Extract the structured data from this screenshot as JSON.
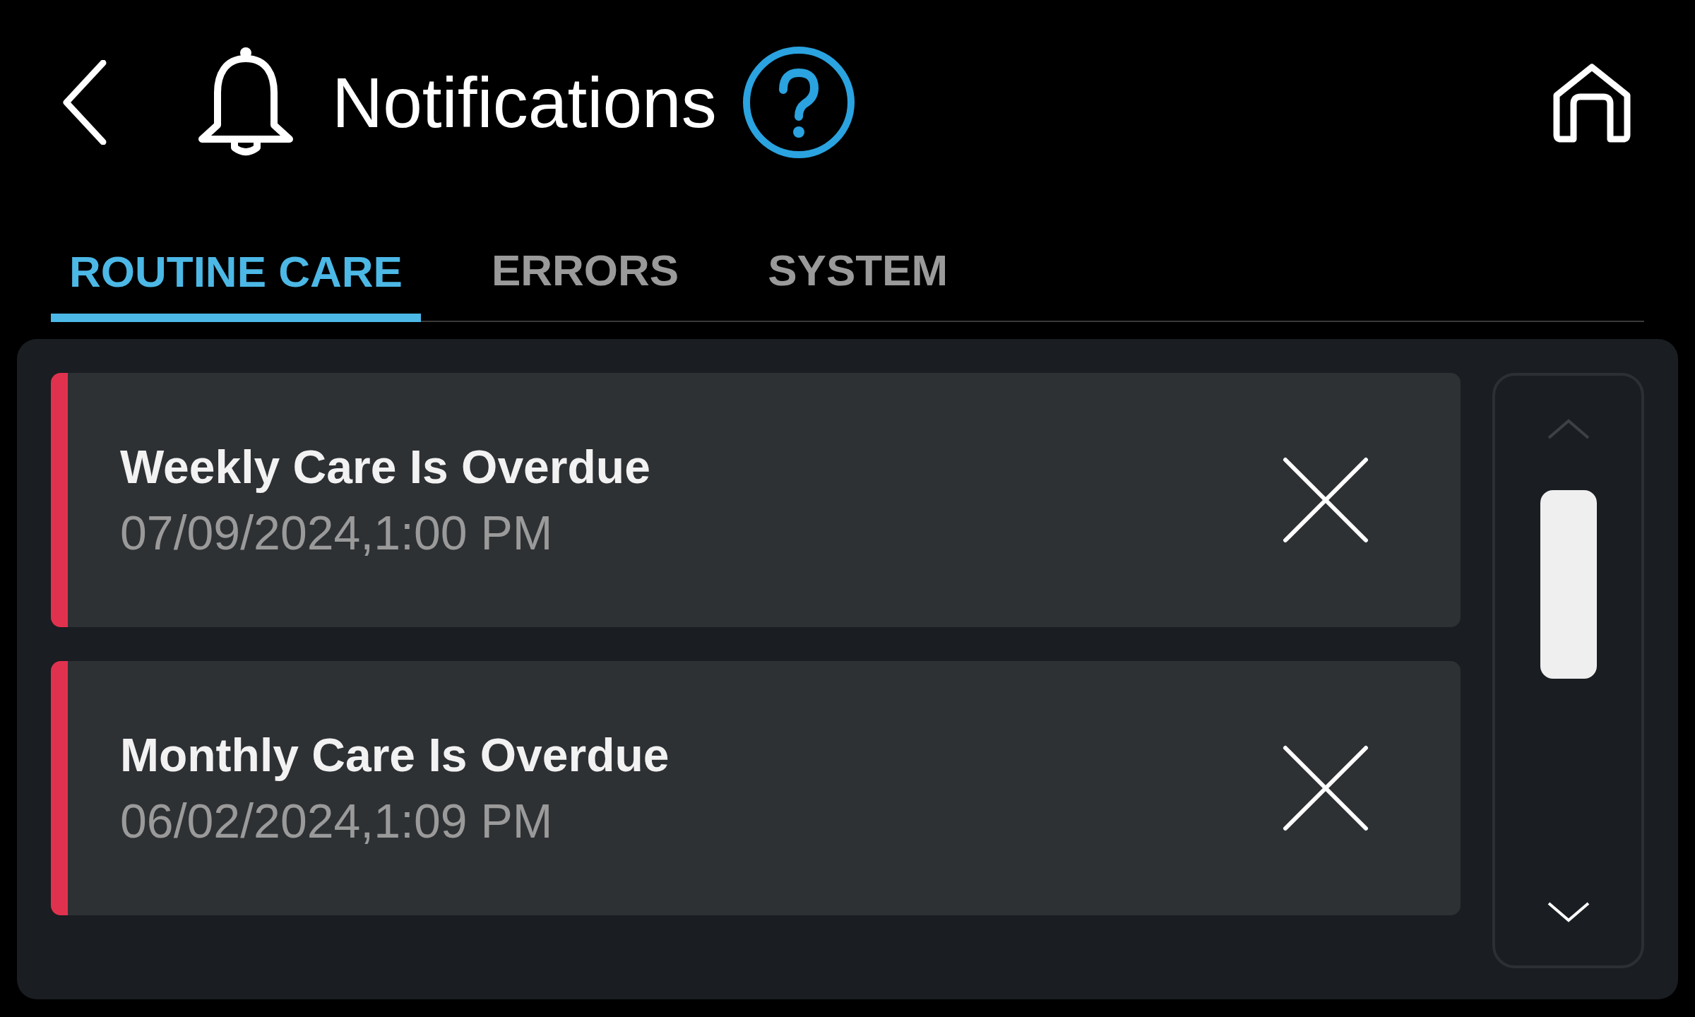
{
  "header": {
    "title": "Notifications"
  },
  "tabs": [
    {
      "label": "ROUTINE CARE",
      "selected": true
    },
    {
      "label": "ERRORS",
      "selected": false
    },
    {
      "label": "SYSTEM",
      "selected": false
    }
  ],
  "notifications": [
    {
      "title": "Weekly Care Is Overdue",
      "timestamp": "07/09/2024,1:00 PM"
    },
    {
      "title": "Monthly Care Is Overdue",
      "timestamp": "06/02/2024,1:09 PM"
    }
  ]
}
